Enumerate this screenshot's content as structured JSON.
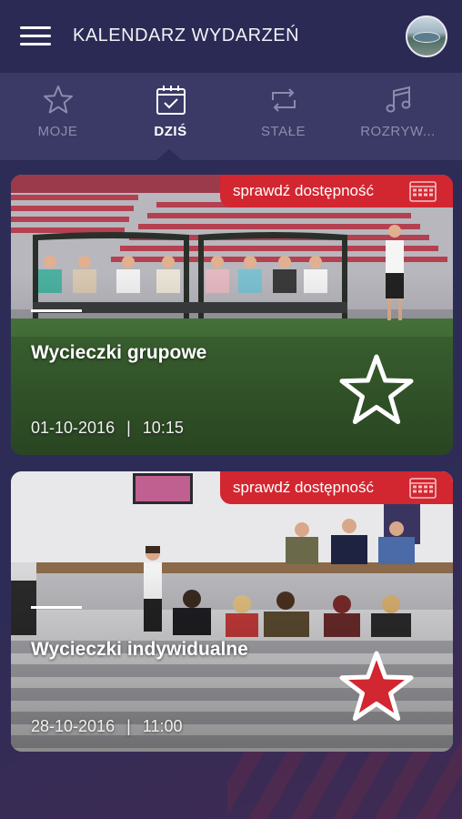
{
  "app": {
    "title": "KALENDARZ WYDARZEŃ",
    "accent_color": "#d22630",
    "background_color": "#2d2c57"
  },
  "header": {
    "menu_icon": "hamburger-menu-icon",
    "avatar_icon": "user-avatar"
  },
  "tabs": [
    {
      "label": "MOJE",
      "icon": "star-outline-icon",
      "active": false
    },
    {
      "label": "DZIŚ",
      "icon": "calendar-check-icon",
      "active": true
    },
    {
      "label": "STAŁE",
      "icon": "repeat-icon",
      "active": false
    },
    {
      "label": "ROZRYW...",
      "icon": "music-note-icon",
      "active": false
    }
  ],
  "events": [
    {
      "title": "Wycieczki grupowe",
      "date": "01-10-2016",
      "time": "10:15",
      "separator": "|",
      "availability_label": "sprawdź dostępność",
      "availability_icon": "calendar-grid-icon",
      "favorite": false,
      "favorite_icon": "star-outline-icon"
    },
    {
      "title": "Wycieczki indywidualne",
      "date": "28-10-2016",
      "time": "11:00",
      "separator": "|",
      "availability_label": "sprawdź dostępność",
      "availability_icon": "calendar-grid-icon",
      "favorite": true,
      "favorite_icon": "star-filled-icon"
    }
  ]
}
